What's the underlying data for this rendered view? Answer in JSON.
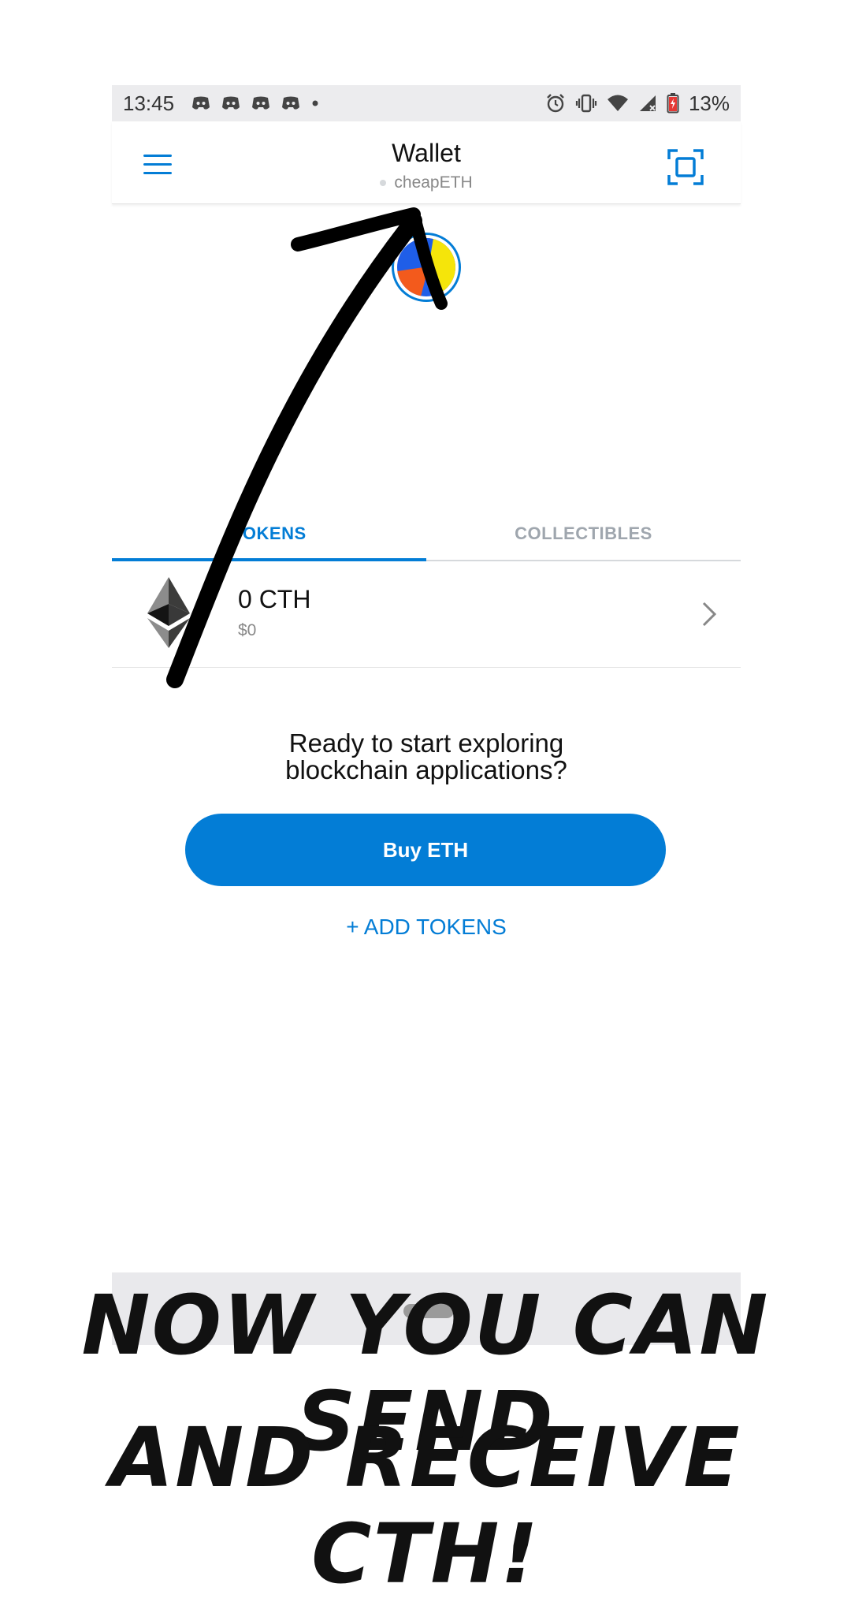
{
  "status_bar": {
    "time": "13:45",
    "battery": "13%",
    "icons": [
      "discord-icon",
      "discord-icon",
      "discord-icon",
      "discord-icon",
      "dot",
      "alarm-icon",
      "vibrate-icon",
      "wifi-icon",
      "signal-icon",
      "battery-icon"
    ]
  },
  "header": {
    "title": "Wallet",
    "network": "cheapETH"
  },
  "tabs": [
    {
      "label": "TOKENS",
      "active": true
    },
    {
      "label": "COLLECTIBLES",
      "active": false
    }
  ],
  "tokens": [
    {
      "amount": "0 CTH",
      "fiat": "$0",
      "icon": "ethereum-icon"
    }
  ],
  "explore": {
    "line1": "Ready to start exploring",
    "line2": "blockchain applications?"
  },
  "buy_button": "Buy ETH",
  "add_tokens": "+ ADD TOKENS",
  "caption": {
    "line1": "NOW YOU CAN SEND",
    "line2": "AND RECEIVE CTH!"
  },
  "colors": {
    "accent": "#037dd6",
    "muted_text": "#9fa6ae",
    "status_bar_bg": "#ececee"
  }
}
